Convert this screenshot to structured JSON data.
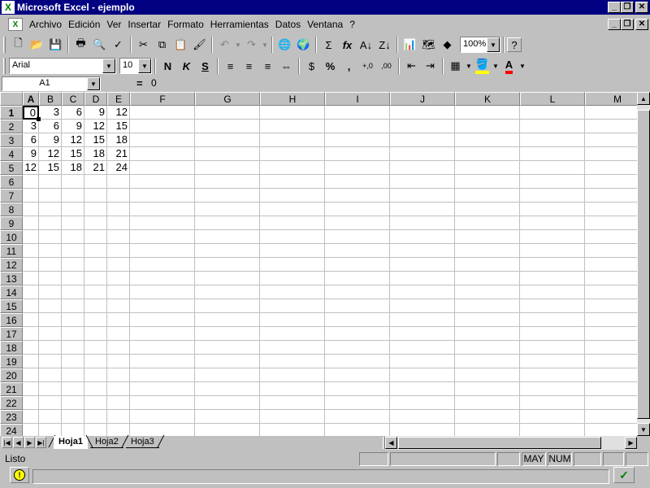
{
  "window": {
    "title": "Microsoft Excel - ejemplo",
    "app_icon": "excel-x-icon"
  },
  "menu": {
    "items": [
      {
        "label": "Archivo",
        "accel": "A"
      },
      {
        "label": "Edición",
        "accel": "E"
      },
      {
        "label": "Ver",
        "accel": "V"
      },
      {
        "label": "Insertar",
        "accel": "I"
      },
      {
        "label": "Formato",
        "accel": "F"
      },
      {
        "label": "Herramientas",
        "accel": "H"
      },
      {
        "label": "Datos",
        "accel": "D"
      },
      {
        "label": "Ventana",
        "accel": "n"
      },
      {
        "label": "?",
        "accel": "?"
      }
    ]
  },
  "toolbar": {
    "zoom": "100%",
    "font_name": "Arial",
    "font_size": "10",
    "bold": "N",
    "italic": "K",
    "underline": "S",
    "sum": "Σ",
    "fx": "fx",
    "percent": "%",
    "thousands": ",",
    "inc_decimals": "+,0",
    "dec_decimals": ",00",
    "font_color_letter": "A",
    "fill_color": "#ffff00",
    "font_color": "#ff0000"
  },
  "formula_bar": {
    "name_box": "A1",
    "equals": "=",
    "content": "0"
  },
  "grid": {
    "columns": [
      "A",
      "B",
      "C",
      "D",
      "E",
      "F",
      "G",
      "H",
      "I",
      "J",
      "K",
      "L",
      "M"
    ],
    "rows": [
      "1",
      "2",
      "3",
      "4",
      "5",
      "6",
      "7",
      "8",
      "9",
      "10",
      "11",
      "12",
      "13",
      "14",
      "15",
      "16",
      "17",
      "18",
      "19",
      "20",
      "21",
      "22",
      "23",
      "24"
    ],
    "active_cell": "A1",
    "data": [
      [
        "0",
        "3",
        "6",
        "9",
        "12"
      ],
      [
        "3",
        "6",
        "9",
        "12",
        "15"
      ],
      [
        "6",
        "9",
        "12",
        "15",
        "18"
      ],
      [
        "9",
        "12",
        "15",
        "18",
        "21"
      ],
      [
        "12",
        "15",
        "18",
        "21",
        "24"
      ]
    ]
  },
  "sheets": {
    "tabs": [
      "Hoja1",
      "Hoja2",
      "Hoja3"
    ],
    "active": "Hoja1"
  },
  "status": {
    "text": "Listo",
    "caps": "MAY",
    "num": "NUM"
  }
}
